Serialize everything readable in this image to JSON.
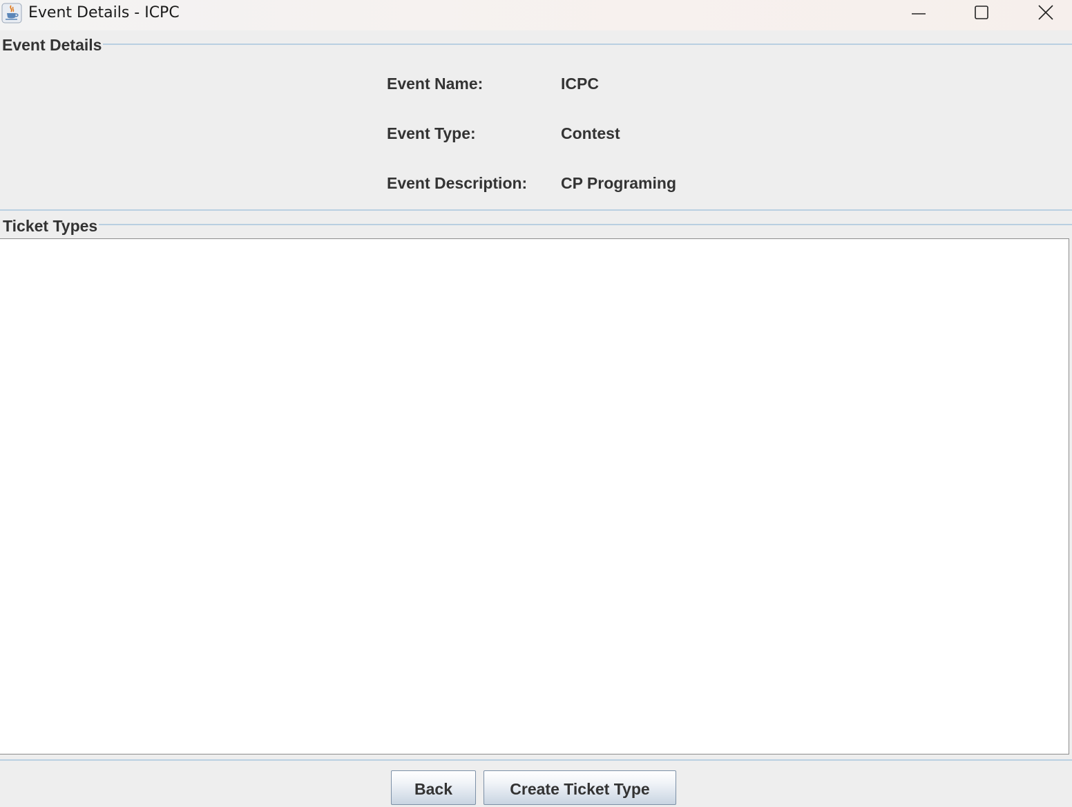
{
  "window": {
    "title": "Event Details - ICPC",
    "icons": {
      "app": "java-cup-icon",
      "minimize": "minimize-icon",
      "maximize": "maximize-icon",
      "close": "close-icon"
    }
  },
  "event_details": {
    "section_title": "Event Details",
    "fields": [
      {
        "label": "Event Name:",
        "value": "ICPC"
      },
      {
        "label": "Event Type:",
        "value": "Contest"
      },
      {
        "label": "Event Description:",
        "value": "CP Programing"
      }
    ]
  },
  "ticket_types": {
    "section_title": "Ticket Types",
    "rows": []
  },
  "buttons": {
    "back": "Back",
    "create_ticket_type": "Create Ticket Type"
  },
  "colors": {
    "background": "#eeeeee",
    "border_accent": "#b9cfe1",
    "text": "#333333",
    "table_background": "#ffffff"
  }
}
